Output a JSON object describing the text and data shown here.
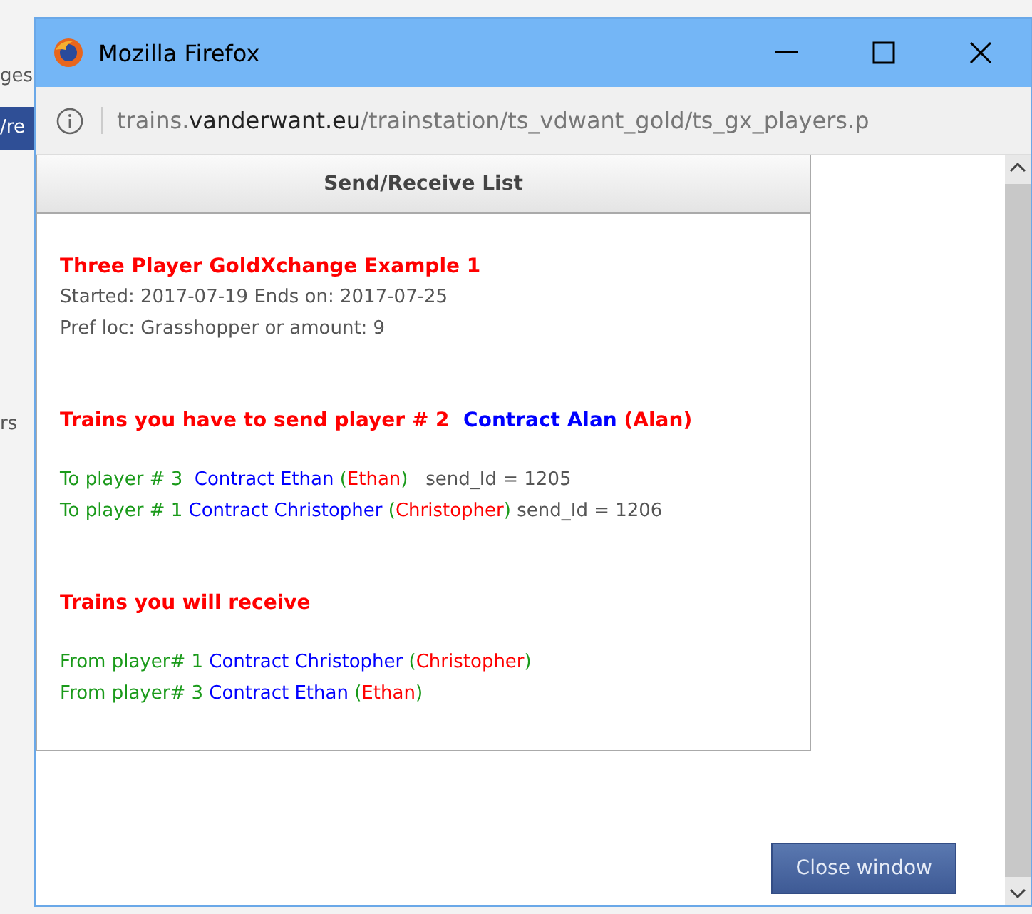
{
  "background_page": {
    "fragments": [
      {
        "text": "ges",
        "kind": "plain"
      },
      {
        "text": "/re",
        "kind": "banner"
      },
      {
        "text": "rs",
        "kind": "plain"
      }
    ]
  },
  "window": {
    "title": "Mozilla Firefox"
  },
  "address_bar": {
    "host_prefix": "trains.",
    "domain": "vanderwant.eu",
    "path": "/trainstation/ts_vdwant_gold/ts_gx_players.p"
  },
  "panel": {
    "header": "Send/Receive List",
    "blocks": [
      {
        "kind": "title",
        "lines": [
          [
            {
              "text": "Three Player GoldXchange Example 1",
              "color": "#ff0000"
            }
          ]
        ]
      },
      {
        "kind": "info",
        "lines": [
          [
            {
              "text": "Started: 2017-07-19 Ends on: 2017-07-25",
              "color": "#555555"
            }
          ],
          [
            {
              "text": "Pref loc: Grasshopper or amount: 9",
              "color": "#555555"
            }
          ]
        ]
      },
      {
        "kind": "heading",
        "lines": [
          [
            {
              "text": "Trains you have to send player # 2 ",
              "color": "#ff0000"
            },
            {
              "text": " Contract Alan ",
              "color": "#0000ff"
            },
            {
              "text": "(Alan)",
              "color": "#ff0000"
            }
          ]
        ]
      },
      {
        "kind": "list",
        "lines": [
          [
            {
              "text": "To player # 3 ",
              "color": "#1a9a1a"
            },
            {
              "text": " Contract Ethan ",
              "color": "#0000ff"
            },
            {
              "text": "(",
              "color": "#1a9a1a"
            },
            {
              "text": "Ethan",
              "color": "#ff0000"
            },
            {
              "text": ")",
              "color": "#1a9a1a"
            },
            {
              "text": "   send_Id = 1205",
              "color": "#555555"
            }
          ],
          [
            {
              "text": "To player # 1 ",
              "color": "#1a9a1a"
            },
            {
              "text": "Contract Christopher ",
              "color": "#0000ff"
            },
            {
              "text": "(",
              "color": "#1a9a1a"
            },
            {
              "text": "Christopher",
              "color": "#ff0000"
            },
            {
              "text": ")",
              "color": "#1a9a1a"
            },
            {
              "text": " send_Id = 1206",
              "color": "#555555"
            }
          ]
        ]
      },
      {
        "kind": "heading",
        "lines": [
          [
            {
              "text": "Trains you will receive",
              "color": "#ff0000"
            }
          ]
        ]
      },
      {
        "kind": "list",
        "lines": [
          [
            {
              "text": "From player# 1 ",
              "color": "#1a9a1a"
            },
            {
              "text": "Contract Christopher ",
              "color": "#0000ff"
            },
            {
              "text": "(",
              "color": "#1a9a1a"
            },
            {
              "text": "Christopher",
              "color": "#ff0000"
            },
            {
              "text": ")",
              "color": "#1a9a1a"
            }
          ],
          [
            {
              "text": "From player# 3 ",
              "color": "#1a9a1a"
            },
            {
              "text": "Contract Ethan ",
              "color": "#0000ff"
            },
            {
              "text": "(",
              "color": "#1a9a1a"
            },
            {
              "text": "Ethan",
              "color": "#ff0000"
            },
            {
              "text": ")",
              "color": "#1a9a1a"
            }
          ]
        ]
      }
    ]
  },
  "close_button": "Close window"
}
